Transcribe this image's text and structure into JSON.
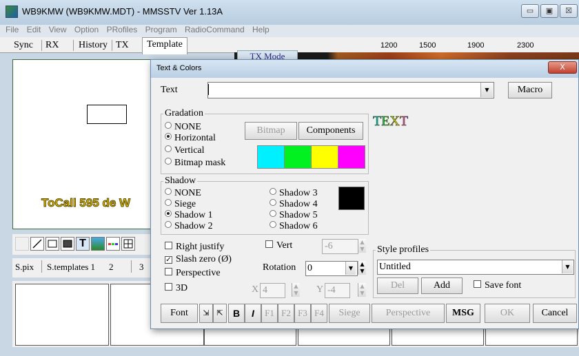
{
  "app": {
    "title": "WB9KMW (WB9KMW.MDT) - MMSSTV Ver 1.13A"
  },
  "window_buttons": {
    "minimize": "▭",
    "maximize": "▣",
    "close": "☒"
  },
  "menu": [
    "File",
    "Edit",
    "View",
    "Option",
    "PRofiles",
    "Program",
    "RadioCommand",
    "Help"
  ],
  "tabs": [
    "Sync",
    "RX",
    "History",
    "TX",
    "Template"
  ],
  "freq_labels": [
    "1200",
    "1500",
    "1900",
    "2300"
  ],
  "tx_mode": "TX Mode",
  "canvas": {
    "overlay_text": "ToCall 595 de W"
  },
  "toolbar_icons": [
    "pointer-icon",
    "line-icon",
    "rect-icon",
    "filled-rect-icon",
    "text-icon",
    "image-icon",
    "color-bar-icon",
    "grid-icon"
  ],
  "text_tool_label": "T",
  "bottom_tabs": [
    "S.pix",
    "S.templates 1",
    "2",
    "3"
  ],
  "dialog": {
    "title": "Text & Colors",
    "close_label": "X",
    "text_label": "Text",
    "text_value": "",
    "macro_button": "Macro",
    "gradation": {
      "label": "Gradation",
      "options": [
        "NONE",
        "Horizontal",
        "Vertical",
        "Bitmap mask"
      ],
      "selected": "Horizontal",
      "bitmap_button": "Bitmap",
      "components_button": "Components",
      "colors": [
        "#00f0ff",
        "#00f020",
        "#ffff00",
        "#ff00ff"
      ]
    },
    "preview_text": "TEXT",
    "shadow": {
      "label": "Shadow",
      "options_left": [
        "NONE",
        "Siege",
        "Shadow 1",
        "Shadow 2"
      ],
      "options_right": [
        "Shadow 3",
        "Shadow 4",
        "Shadow 5",
        "Shadow 6"
      ],
      "selected": "Shadow 1",
      "color": "#000000"
    },
    "options": {
      "right_justify": "Right justify",
      "slash_zero": "Slash zero (Ø)",
      "slash_zero_checked": true,
      "perspective": "Perspective",
      "three_d": "3D",
      "vert": "Vert",
      "vert_value": "-6",
      "rotation_label": "Rotation",
      "rotation_value": "0",
      "x_label": "X",
      "x_value": "4",
      "y_label": "Y",
      "y_value": "-4"
    },
    "style_profiles": {
      "label": "Style profiles",
      "selected": "Untitled",
      "del_button": "Del",
      "add_button": "Add",
      "save_font": "Save font"
    },
    "bottom_buttons": {
      "font": "Font",
      "bold": "B",
      "italic": "I",
      "f1": "F1",
      "f2": "F2",
      "f3": "F3",
      "f4": "F4",
      "siege": "Siege",
      "perspective": "Perspective",
      "msg": "MSG",
      "ok": "OK",
      "cancel": "Cancel"
    }
  }
}
